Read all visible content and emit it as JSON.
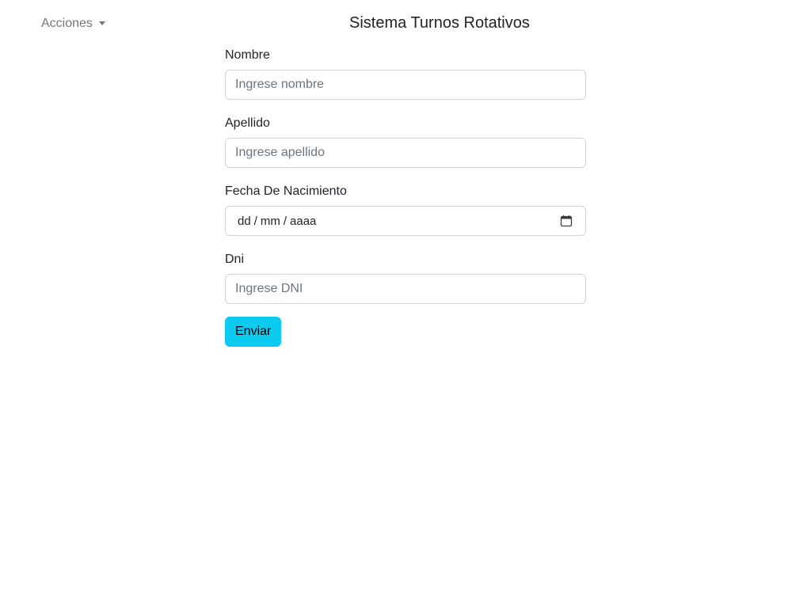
{
  "nav": {
    "actions_label": "Acciones"
  },
  "header": {
    "title": "Sistema Turnos Rotativos"
  },
  "form": {
    "nombre": {
      "label": "Nombre",
      "placeholder": "Ingrese nombre"
    },
    "apellido": {
      "label": "Apellido",
      "placeholder": "Ingrese apellido"
    },
    "fecha": {
      "label": "Fecha De Nacimiento",
      "day": "dd",
      "month": "mm",
      "year": "aaaa",
      "sep": "/"
    },
    "dni": {
      "label": "Dni",
      "placeholder": "Ingrese DNI"
    },
    "submit_label": "Enviar"
  },
  "icons": {
    "dropdown": "chevron-down-icon",
    "calendar": "calendar-icon"
  },
  "colors": {
    "button": "#0dcaf0",
    "input_border": "#ced4da"
  }
}
